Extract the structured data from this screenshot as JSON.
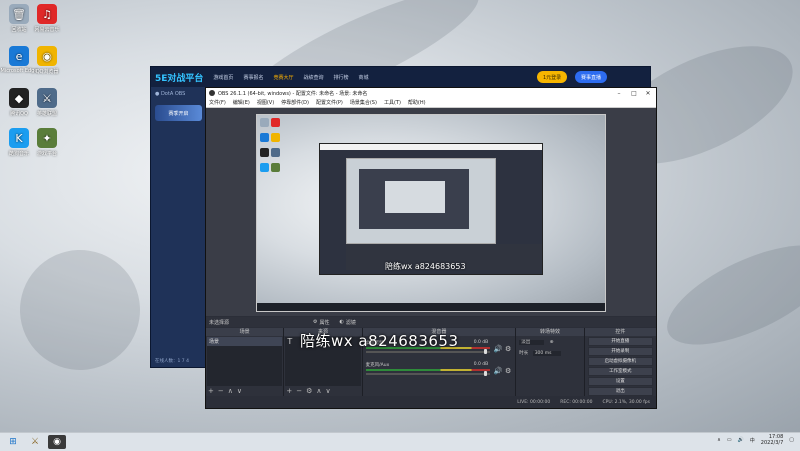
{
  "desktop": {
    "icons": [
      {
        "label": "回收站",
        "glyph": "🗑",
        "color": "#9ab"
      },
      {
        "label": "网易云音乐",
        "glyph": "♫",
        "color": "#e02828"
      },
      {
        "label": "Microsoft Edge",
        "glyph": "e",
        "color": "#1979d6"
      },
      {
        "label": "QQ浏览器",
        "glyph": "◉",
        "color": "#f0b400"
      },
      {
        "label": "腾讯QQ",
        "glyph": "◆",
        "color": "#222"
      },
      {
        "label": "英雄联盟",
        "glyph": "⚔",
        "color": "#4f6b8a"
      },
      {
        "label": "酷狗音乐",
        "glyph": "K",
        "color": "#1b9df0"
      },
      {
        "label": "游戏平台",
        "glyph": "✦",
        "color": "#5a7d3a"
      }
    ]
  },
  "app": {
    "logo": "5E对战平台",
    "menu": [
      "游戏首页",
      "赛事报名",
      "竞赛大厅",
      "战绩查询",
      "排行榜",
      "商城"
    ],
    "active_menu": "竞赛大厅",
    "pill_primary": "1元登录",
    "pill_secondary": "赛事直播",
    "left_header": "● DotA OBS",
    "banner": "赛季开启",
    "status": "在线人数：1 7 4"
  },
  "obs": {
    "title": "OBS 26.1.1 (64-bit, windows) - 配置文件: 未命名 - 场景: 未命名",
    "menu": [
      "文件(F)",
      "编辑(E)",
      "视图(V)",
      "停靠部件(D)",
      "配置文件(P)",
      "场景集合(S)",
      "工具(T)",
      "帮助(H)"
    ],
    "no_source": "未选择源",
    "source_props": "属性",
    "source_filters": "滤镜",
    "docks": {
      "scenes": {
        "header": "场景",
        "item": "场景"
      },
      "sources": {
        "header": "来源"
      },
      "mixer": {
        "header": "混音器",
        "channels": [
          {
            "name": "桌面音频",
            "db": "0.0 dB"
          },
          {
            "name": "麦克风/Aux",
            "db": "0.0 dB"
          }
        ]
      },
      "transitions": {
        "header": "转场特效",
        "type": "淡出",
        "duration_label": "时长",
        "duration": "300 ms"
      },
      "controls": {
        "header": "控件",
        "buttons": [
          "开始直播",
          "开始录制",
          "启动虚拟摄像机",
          "工作室模式",
          "设置",
          "退出"
        ]
      }
    },
    "status": {
      "live": "LIVE: 00:00:00",
      "rec": "REC: 00:00:00",
      "cpu": "CPU: 2.1%, 30.00 fps"
    }
  },
  "watermark": "陪练wx  a824683653",
  "nested_watermark": "陪练wx  a824683653",
  "taskbar": {
    "items": [
      "⊞",
      "⚔",
      "◉"
    ],
    "time": "17:08",
    "date": "2022/3/7"
  }
}
